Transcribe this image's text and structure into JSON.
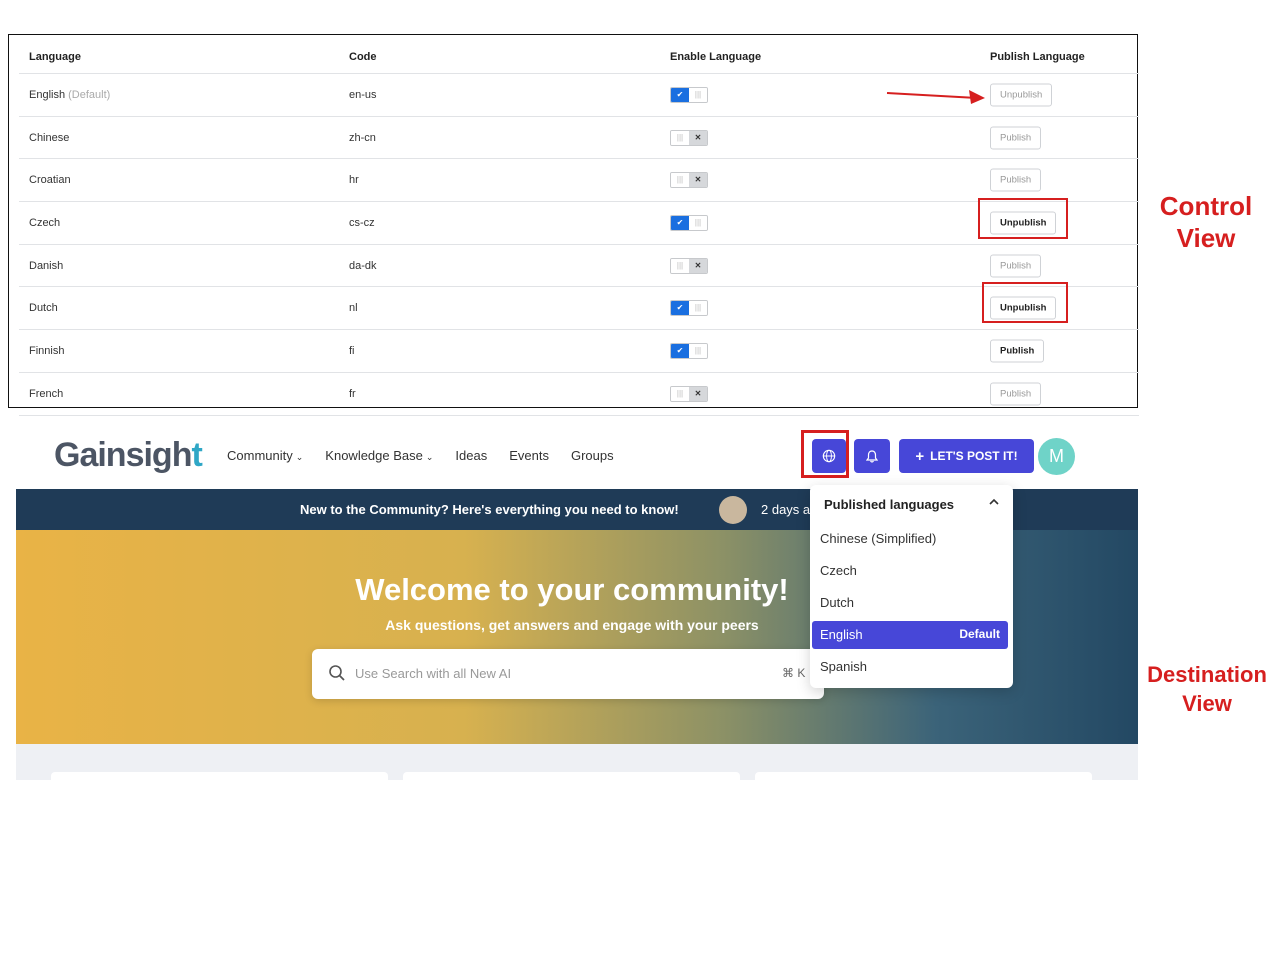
{
  "control_view": {
    "columns": [
      "Language",
      "Code",
      "Enable Language",
      "Publish Language"
    ],
    "default_tag": "(Default)",
    "rows": [
      {
        "language": "English",
        "is_default": true,
        "code": "en-us",
        "enabled": true,
        "button": "Unpublish",
        "emphasis": false
      },
      {
        "language": "Chinese",
        "is_default": false,
        "code": "zh-cn",
        "enabled": false,
        "button": "Publish",
        "emphasis": false
      },
      {
        "language": "Croatian",
        "is_default": false,
        "code": "hr",
        "enabled": false,
        "button": "Publish",
        "emphasis": false
      },
      {
        "language": "Czech",
        "is_default": false,
        "code": "cs-cz",
        "enabled": true,
        "button": "Unpublish",
        "emphasis": true
      },
      {
        "language": "Danish",
        "is_default": false,
        "code": "da-dk",
        "enabled": false,
        "button": "Publish",
        "emphasis": false
      },
      {
        "language": "Dutch",
        "is_default": false,
        "code": "nl",
        "enabled": true,
        "button": "Unpublish",
        "emphasis": true
      },
      {
        "language": "Finnish",
        "is_default": false,
        "code": "fi",
        "enabled": true,
        "button": "Publish",
        "emphasis": true
      },
      {
        "language": "French",
        "is_default": false,
        "code": "fr",
        "enabled": false,
        "button": "Publish",
        "emphasis": false
      }
    ]
  },
  "labels": {
    "control": "Control View",
    "destination": "Destination View"
  },
  "destination_view": {
    "logo": {
      "main": "Gainsigh",
      "accent": "t"
    },
    "nav": [
      {
        "label": "Community",
        "dropdown": true
      },
      {
        "label": "Knowledge Base",
        "dropdown": true
      },
      {
        "label": "Ideas",
        "dropdown": false
      },
      {
        "label": "Events",
        "dropdown": false
      },
      {
        "label": "Groups",
        "dropdown": false
      }
    ],
    "post_button": "LET'S POST IT!",
    "avatar_initial": "M",
    "banner_text": "New to the Community? Here's everything you need to know!",
    "banner_time": "2 days a",
    "hero_title": "Welcome to your community!",
    "hero_subtitle": "Ask questions, get answers and engage with your peers",
    "search_placeholder": "Use Search with all New AI",
    "search_shortcut": "⌘ K",
    "dropdown": {
      "header": "Published languages",
      "items": [
        {
          "label": "Chinese (Simplified)",
          "selected": false,
          "badge": ""
        },
        {
          "label": "Czech",
          "selected": false,
          "badge": ""
        },
        {
          "label": "Dutch",
          "selected": false,
          "badge": ""
        },
        {
          "label": "English",
          "selected": true,
          "badge": "Default"
        },
        {
          "label": "Spanish",
          "selected": false,
          "badge": ""
        }
      ]
    }
  },
  "colors": {
    "accent": "#4747d8",
    "annotation_red": "#d61f1f",
    "toggle_on": "#1a6fe0",
    "banner": "#1f3b57",
    "logo_accent": "#2fa7c6"
  },
  "icons": [
    "arrow-right-icon",
    "globe-icon",
    "bell-icon",
    "plus-icon",
    "search-icon",
    "chevron-up-icon",
    "chevron-down-icon"
  ]
}
